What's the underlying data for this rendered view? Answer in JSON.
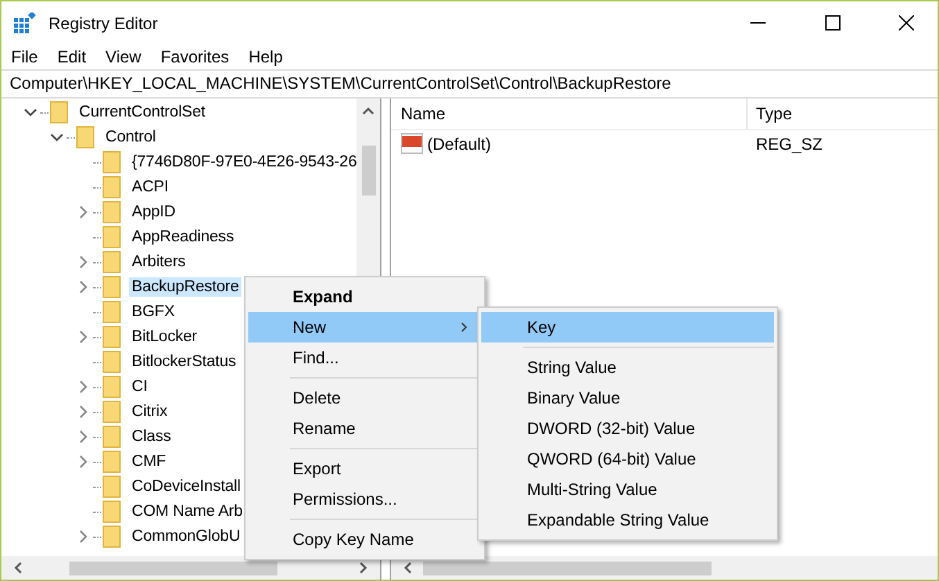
{
  "window": {
    "title": "Registry Editor"
  },
  "menu_bar": [
    "File",
    "Edit",
    "View",
    "Favorites",
    "Help"
  ],
  "address_bar": {
    "value": "Computer\\HKEY_LOCAL_MACHINE\\SYSTEM\\CurrentControlSet\\Control\\BackupRestore"
  },
  "tree": [
    {
      "label": "CurrentControlSet",
      "kind": "branch",
      "expanded": true,
      "selected": false,
      "children": [
        {
          "label": "Control",
          "kind": "branch",
          "expanded": true,
          "selected": false,
          "children": [
            {
              "label": "{7746D80F-97E0-4E26-9543-26",
              "kind": "leaf",
              "selected": false
            },
            {
              "label": "ACPI",
              "kind": "leaf",
              "selected": false
            },
            {
              "label": "AppID",
              "kind": "branch",
              "expanded": false,
              "selected": false
            },
            {
              "label": "AppReadiness",
              "kind": "leaf",
              "selected": false
            },
            {
              "label": "Arbiters",
              "kind": "branch",
              "expanded": false,
              "selected": false
            },
            {
              "label": "BackupRestore",
              "kind": "branch",
              "expanded": false,
              "selected": true
            },
            {
              "label": "BGFX",
              "kind": "leaf",
              "selected": false
            },
            {
              "label": "BitLocker",
              "kind": "branch",
              "expanded": false,
              "selected": false
            },
            {
              "label": "BitlockerStatus",
              "kind": "leaf",
              "selected": false
            },
            {
              "label": "CI",
              "kind": "branch",
              "expanded": false,
              "selected": false
            },
            {
              "label": "Citrix",
              "kind": "branch",
              "expanded": false,
              "selected": false
            },
            {
              "label": "Class",
              "kind": "branch",
              "expanded": false,
              "selected": false
            },
            {
              "label": "CMF",
              "kind": "branch",
              "expanded": false,
              "selected": false
            },
            {
              "label": "CoDeviceInstall",
              "kind": "leaf",
              "selected": false
            },
            {
              "label": "COM Name Arb",
              "kind": "leaf",
              "selected": false
            },
            {
              "label": "CommonGlobU",
              "kind": "branch",
              "expanded": false,
              "selected": false
            }
          ]
        }
      ]
    }
  ],
  "values_table": {
    "columns": [
      "Name",
      "Type"
    ],
    "rows": [
      {
        "name": "(Default)",
        "type": "REG_SZ"
      }
    ]
  },
  "context_menu": [
    {
      "kind": "item",
      "label": "Expand",
      "default": true,
      "selected": false,
      "submenu": false
    },
    {
      "kind": "item",
      "label": "New",
      "default": false,
      "selected": true,
      "submenu": true
    },
    {
      "kind": "item",
      "label": "Find...",
      "default": false,
      "selected": false,
      "submenu": false
    },
    {
      "kind": "separator"
    },
    {
      "kind": "item",
      "label": "Delete",
      "default": false,
      "selected": false,
      "submenu": false
    },
    {
      "kind": "item",
      "label": "Rename",
      "default": false,
      "selected": false,
      "submenu": false
    },
    {
      "kind": "separator"
    },
    {
      "kind": "item",
      "label": "Export",
      "default": false,
      "selected": false,
      "submenu": false
    },
    {
      "kind": "item",
      "label": "Permissions...",
      "default": false,
      "selected": false,
      "submenu": false
    },
    {
      "kind": "separator"
    },
    {
      "kind": "item",
      "label": "Copy Key Name",
      "default": false,
      "selected": false,
      "submenu": false
    }
  ],
  "submenu": [
    {
      "kind": "item",
      "label": "Key",
      "selected": true
    },
    {
      "kind": "separator"
    },
    {
      "kind": "item",
      "label": "String Value",
      "selected": false
    },
    {
      "kind": "item",
      "label": "Binary Value",
      "selected": false
    },
    {
      "kind": "item",
      "label": "DWORD (32-bit) Value",
      "selected": false
    },
    {
      "kind": "item",
      "label": "QWORD (64-bit) Value",
      "selected": false
    },
    {
      "kind": "item",
      "label": "Multi-String Value",
      "selected": false
    },
    {
      "kind": "item",
      "label": "Expandable String Value",
      "selected": false
    }
  ]
}
